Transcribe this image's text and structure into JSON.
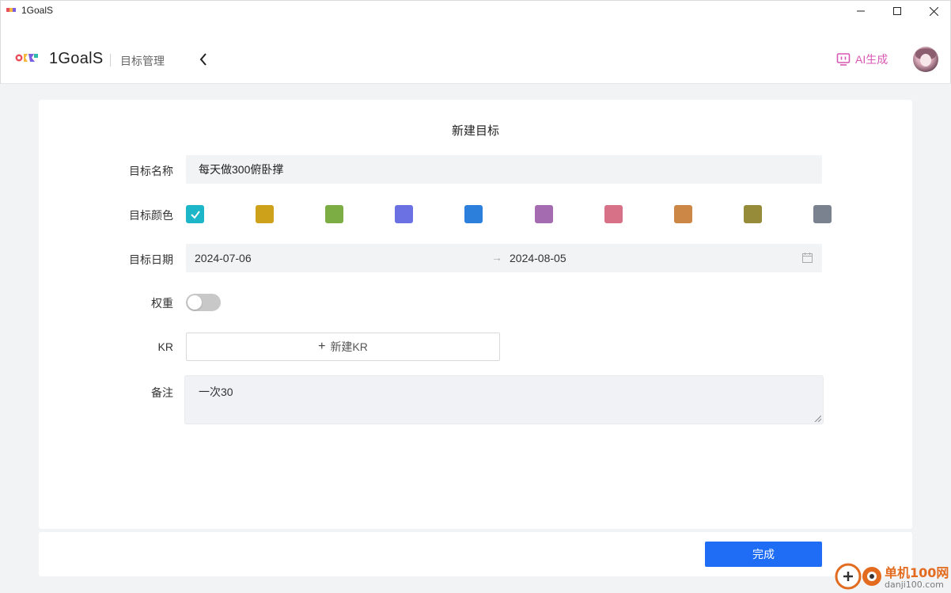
{
  "window": {
    "title": "1GoalS",
    "controls": [
      "minimize",
      "maximize",
      "close"
    ]
  },
  "header": {
    "brand": "1GoalS",
    "section": "目标管理",
    "ai_button": "AI生成",
    "back_icon": "chevron-left-icon",
    "avatar_icon": "user-avatar"
  },
  "form": {
    "title": "新建目标",
    "name": {
      "label": "目标名称",
      "value": "每天做300俯卧撑"
    },
    "color": {
      "label": "目标颜色",
      "selected_index": 0,
      "options": [
        "#1db5c8",
        "#cda11a",
        "#7cad45",
        "#6b70e2",
        "#2d7fdc",
        "#a46bb0",
        "#d77187",
        "#cc8746",
        "#958b39",
        "#7a8290"
      ]
    },
    "date": {
      "label": "目标日期",
      "start": "2024-07-06",
      "separator": "→",
      "end": "2024-08-05",
      "icon": "calendar-icon"
    },
    "weight": {
      "label": "权重",
      "enabled": false
    },
    "kr": {
      "label": "KR",
      "button": "新建KR",
      "icon": "plus-icon"
    },
    "note": {
      "label": "备注",
      "value": "一次30"
    }
  },
  "footer": {
    "done_button": "完成"
  },
  "colors": {
    "primary": "#1f6cf5",
    "ai_accent": "#d857b4",
    "input_bg": "#f2f3f5"
  },
  "watermark": {
    "title": "单机100网",
    "url": "danji100.com"
  }
}
